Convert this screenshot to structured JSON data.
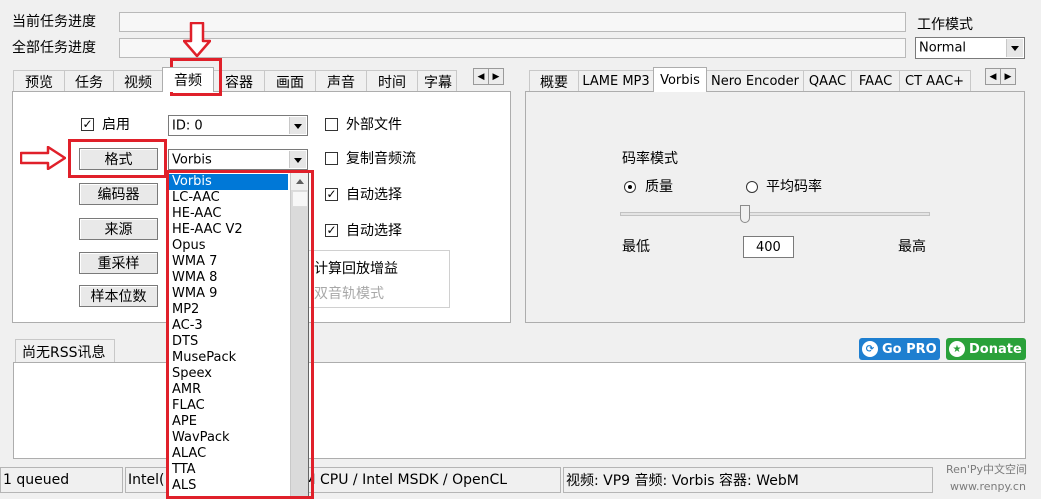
{
  "progress": {
    "current_label": "当前任务进度",
    "total_label": "全部任务进度"
  },
  "work_mode": {
    "label": "工作模式",
    "value": "Normal"
  },
  "left_tabs": [
    "预览",
    "任务",
    "视频",
    "音频",
    "容器",
    "画面",
    "声音",
    "时间",
    "字幕"
  ],
  "right_tabs": [
    "概要",
    "LAME MP3",
    "Vorbis",
    "Nero Encoder",
    "QAAC",
    "FAAC",
    "CT AAC+"
  ],
  "audio": {
    "enable_label": "启用",
    "id_value": "ID: 0",
    "external_file_label": "外部文件",
    "copy_stream_label": "复制音频流",
    "auto_select_1": "自动选择",
    "auto_select_2": "自动选择",
    "replaygain_label": "计算回放增益",
    "dual_track_label": "双音轨模式",
    "buttons": {
      "format": "格式",
      "encoder": "编码器",
      "source": "来源",
      "resample": "重采样",
      "bitdepth": "样本位数"
    },
    "format_value": "Vorbis",
    "format_options": [
      "Vorbis",
      "LC-AAC",
      "HE-AAC",
      "HE-AAC V2",
      "Opus",
      "WMA 7",
      "WMA 8",
      "WMA 9",
      "MP2",
      "AC-3",
      "DTS",
      "MusePack",
      "Speex",
      "AMR",
      "FLAC",
      "APE",
      "WavPack",
      "ALAC",
      "TTA",
      "ALS"
    ]
  },
  "vorbis": {
    "rate_mode_label": "码率模式",
    "quality_label": "质量",
    "avg_bitrate_label": "平均码率",
    "min_label": "最低",
    "max_label": "最高",
    "value": "400"
  },
  "rss": {
    "tab_label": "尚无RSS讯息"
  },
  "badges": {
    "gopro": "Go PRO",
    "donate": "Donate"
  },
  "status": {
    "queue": "1 queued",
    "cpu": "Intel(",
    "cpu_tail": "M CPU  / Intel MSDK / OpenCL",
    "info": "视频: VP9  音频: Vorbis  容器: WebM"
  },
  "watermark": {
    "line1": "Ren'Py中文空间",
    "line2": "www.renpy.cn"
  },
  "colors": {
    "highlight": "#0078d7",
    "annotation": "#e0202a",
    "gopro": "#1e7fd0",
    "donate": "#2aa13a"
  }
}
